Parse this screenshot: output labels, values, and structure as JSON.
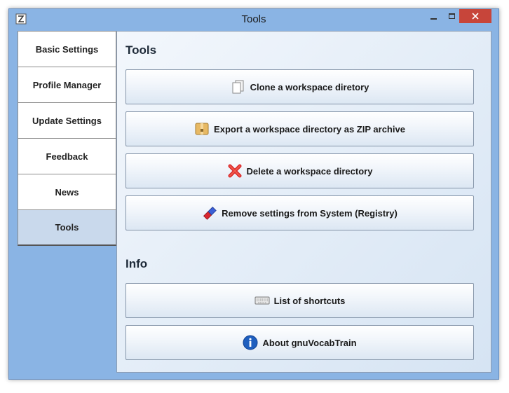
{
  "window": {
    "title": "Tools"
  },
  "sidebar": {
    "items": [
      {
        "label": "Basic Settings"
      },
      {
        "label": "Profile Manager"
      },
      {
        "label": "Update Settings"
      },
      {
        "label": "Feedback"
      },
      {
        "label": "News"
      },
      {
        "label": "Tools",
        "active": true
      }
    ]
  },
  "tools_section": {
    "title": "Tools",
    "buttons": [
      {
        "label": "Clone a workspace diretory",
        "icon": "documents-icon"
      },
      {
        "label": "Export a workspace directory as ZIP archive",
        "icon": "zip-archive-icon"
      },
      {
        "label": "Delete a workspace directory",
        "icon": "red-x-icon"
      },
      {
        "label": "Remove settings from System (Registry)",
        "icon": "eraser-icon"
      }
    ]
  },
  "info_section": {
    "title": "Info",
    "buttons": [
      {
        "label": "List of shortcuts",
        "icon": "keyboard-icon"
      },
      {
        "label": "About gnuVocabTrain",
        "icon": "info-icon"
      }
    ]
  },
  "colors": {
    "window_frame": "#8ab4e4",
    "close_button": "#c7453a",
    "active_tab": "#c9d9ec",
    "content_bg": "#e5eef8"
  }
}
